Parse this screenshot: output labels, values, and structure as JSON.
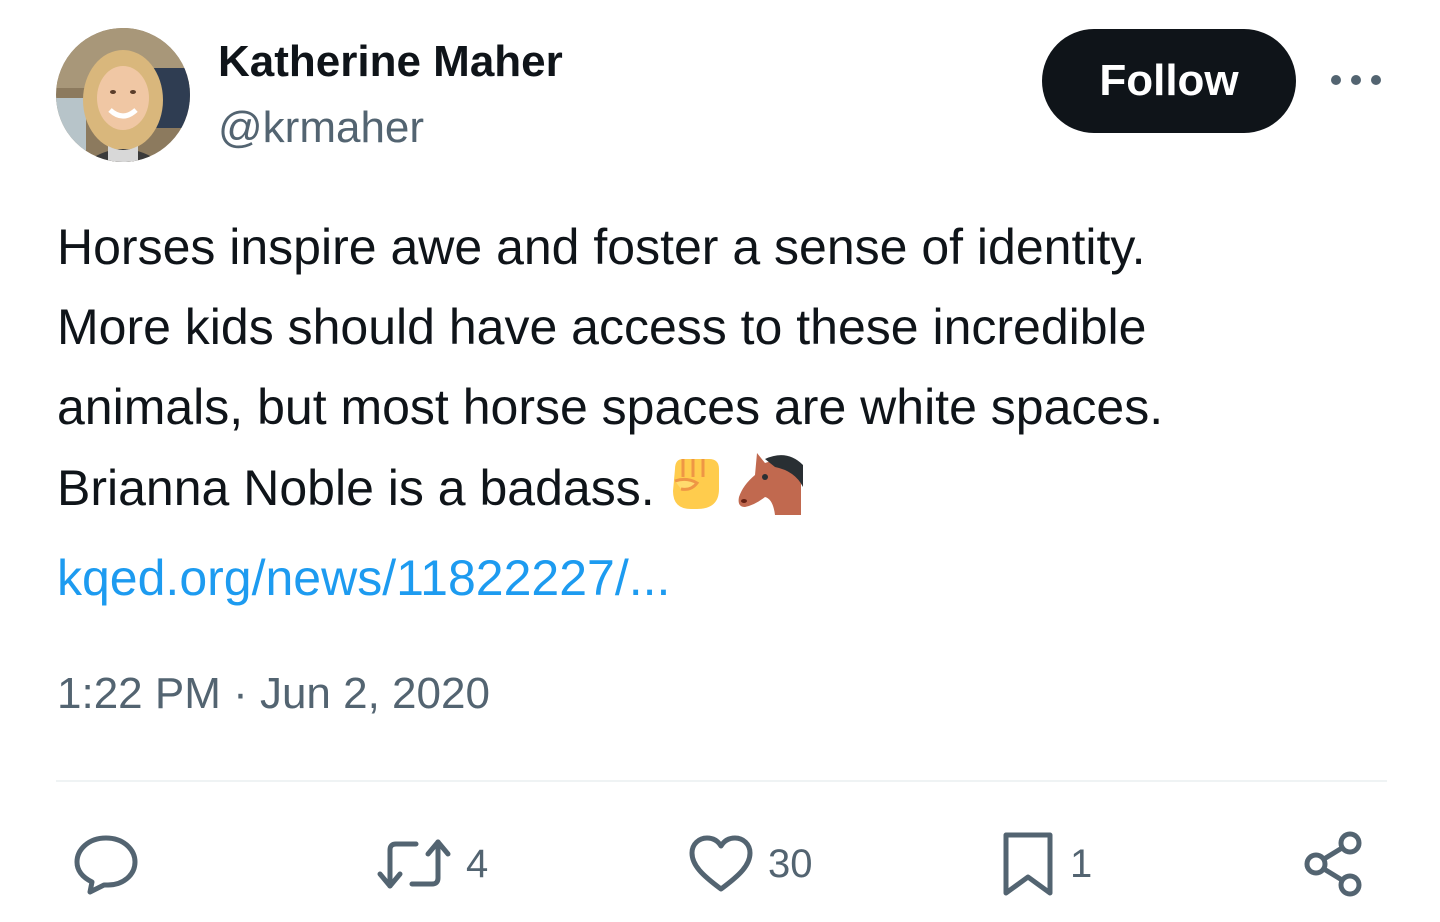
{
  "author": {
    "display_name": "Katherine Maher",
    "handle": "@krmaher"
  },
  "header": {
    "follow_label": "Follow",
    "more_icon": "more-horizontal-icon"
  },
  "tweet": {
    "lines": [
      "Horses inspire awe and foster a sense of identity.",
      "More kids should have access to these incredible",
      "animals, but most horse spaces are white spaces.",
      "Brianna Noble is a badass."
    ],
    "emojis": [
      "raised-fist-emoji",
      "horse-face-emoji"
    ],
    "link_text": "kqed.org/news/11822227/...",
    "timestamp": "1:22 PM · Jun 2, 2020"
  },
  "actions": {
    "reply": {
      "icon": "reply-icon",
      "count": ""
    },
    "retweet": {
      "icon": "retweet-icon",
      "count": "4"
    },
    "like": {
      "icon": "heart-icon",
      "count": "30"
    },
    "bookmark": {
      "icon": "bookmark-icon",
      "count": "1"
    },
    "share": {
      "icon": "share-icon",
      "count": ""
    }
  },
  "colors": {
    "text_primary": "#0f1419",
    "text_secondary": "#536471",
    "link": "#1d9bf0",
    "follow_button_bg": "#0f1419",
    "follow_button_text": "#ffffff",
    "divider": "#eff3f4"
  }
}
